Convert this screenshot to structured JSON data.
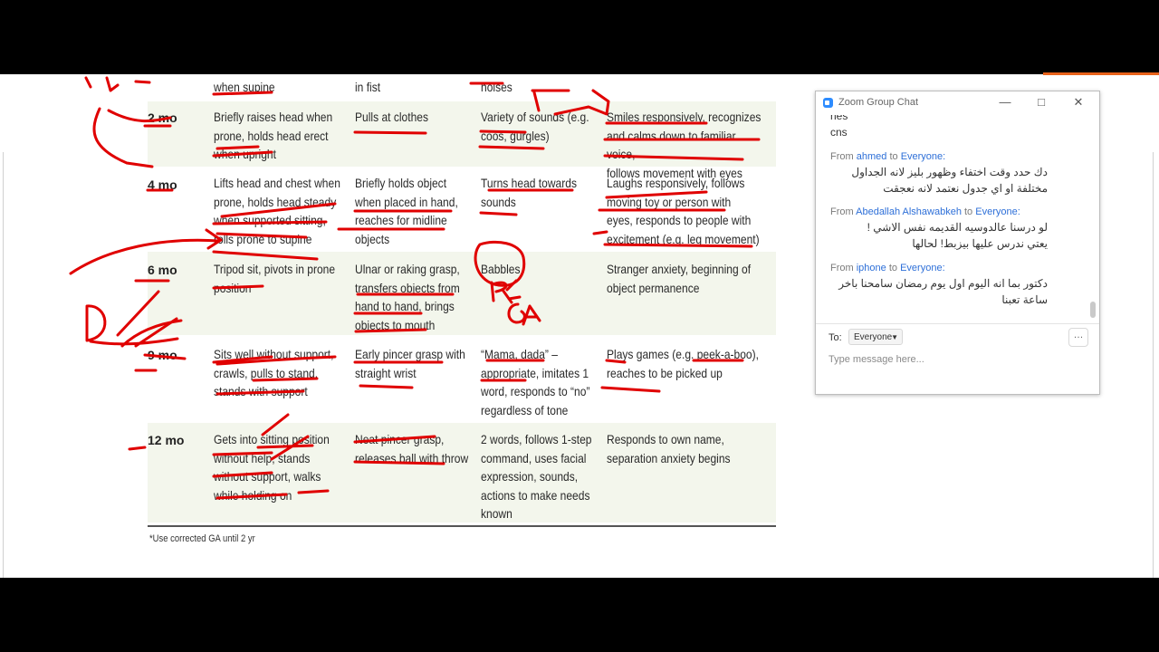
{
  "table": {
    "rows": [
      {
        "age": "",
        "gross_motor": "when supine",
        "fine_motor": "in fist",
        "language": "noises",
        "social": ""
      },
      {
        "age": "2 mo",
        "gross_motor": "Briefly raises head when\nprone, holds head erect\nwhen upright",
        "fine_motor": "Pulls at clothes",
        "language": "Variety of sounds (e.g.\ncoos, gurgles)",
        "social": "Smiles responsively, recognizes\nand calms down to familiar voice,\nfollows movement with eyes"
      },
      {
        "age": "4 mo",
        "gross_motor": "Lifts head and chest when\nprone, holds head steady\nwhen supported sitting,\nrolls prone to supine",
        "fine_motor": "Briefly holds object\nwhen placed in hand,\nreaches for midline\nobjects",
        "language": "Turns head towards\nsounds",
        "social": "Laughs responsively, follows\nmoving toy or person with\neyes, responds to people with\nexcitement (e.g. leg movement)"
      },
      {
        "age": "6 mo",
        "gross_motor": "Tripod sit, pivots in prone\nposition",
        "fine_motor": "Ulnar or raking grasp,\ntransfers objects from\nhand to hand, brings\nobjects to mouth",
        "language": "Babbles",
        "social": "Stranger anxiety, beginning of\nobject permanence"
      },
      {
        "age": "9 mo",
        "gross_motor": "Sits well without support,\ncrawls, pulls to stand,\nstands with support",
        "fine_motor": "Early pincer grasp with\nstraight wrist",
        "language": "“Mama, dada” –\nappropriate, imitates 1\nword, responds to “no”\nregardless of tone",
        "social": "Plays games (e.g. peek-a-boo),\nreaches to be picked up"
      },
      {
        "age": "12 mo",
        "gross_motor": "Gets into sitting position\nwithout help, stands\nwithout support, walks\nwhile holding on",
        "fine_motor": "Neat pincer grasp,\nreleases ball with throw",
        "language": "2 words, follows 1-step\ncommand, uses facial\nexpression, sounds,\nactions to make needs\nknown",
        "social": "Responds to own name,\nseparation anxiety begins"
      }
    ],
    "footnote": "*Use corrected GA until 2 yr",
    "handwritten_annotation": "PA GA",
    "ink_color": "#e00000",
    "band_color": "#f3f6ec"
  },
  "chat": {
    "title": "Zoom Group Chat",
    "minimize_icon": "—",
    "maximize_icon": "□",
    "close_icon": "✕",
    "cut_off_text": "nes",
    "first_message": "cns",
    "messages": [
      {
        "from_label": "From",
        "sender": "ahmed",
        "to_label": "to",
        "recipient": "Everyone:",
        "text": "دك حدد وقت اختفاء وظهور بليز لانه الجداول\nمختلفة او اي جدول نعتمد لانه نعجقت"
      },
      {
        "from_label": "From",
        "sender": "Abedallah Alshawabkeh",
        "to_label": "to",
        "recipient": "Everyone:",
        "text": "لو درسنا عالدوسيه القديمه نفس الاشي !\nيعتي ندرس عليها بيزبط! لحالها"
      },
      {
        "from_label": "From",
        "sender": "iphone",
        "to_label": "to",
        "recipient": "Everyone:",
        "text": "دكتور بما انه اليوم اول يوم رمضان سامحنا باخر\nساعة تعبنا"
      }
    ],
    "to_label": "To:",
    "to_value": "Everyone",
    "more_icon": "…",
    "input_placeholder": "Type message here...",
    "accent_color": "#2d8cff"
  }
}
